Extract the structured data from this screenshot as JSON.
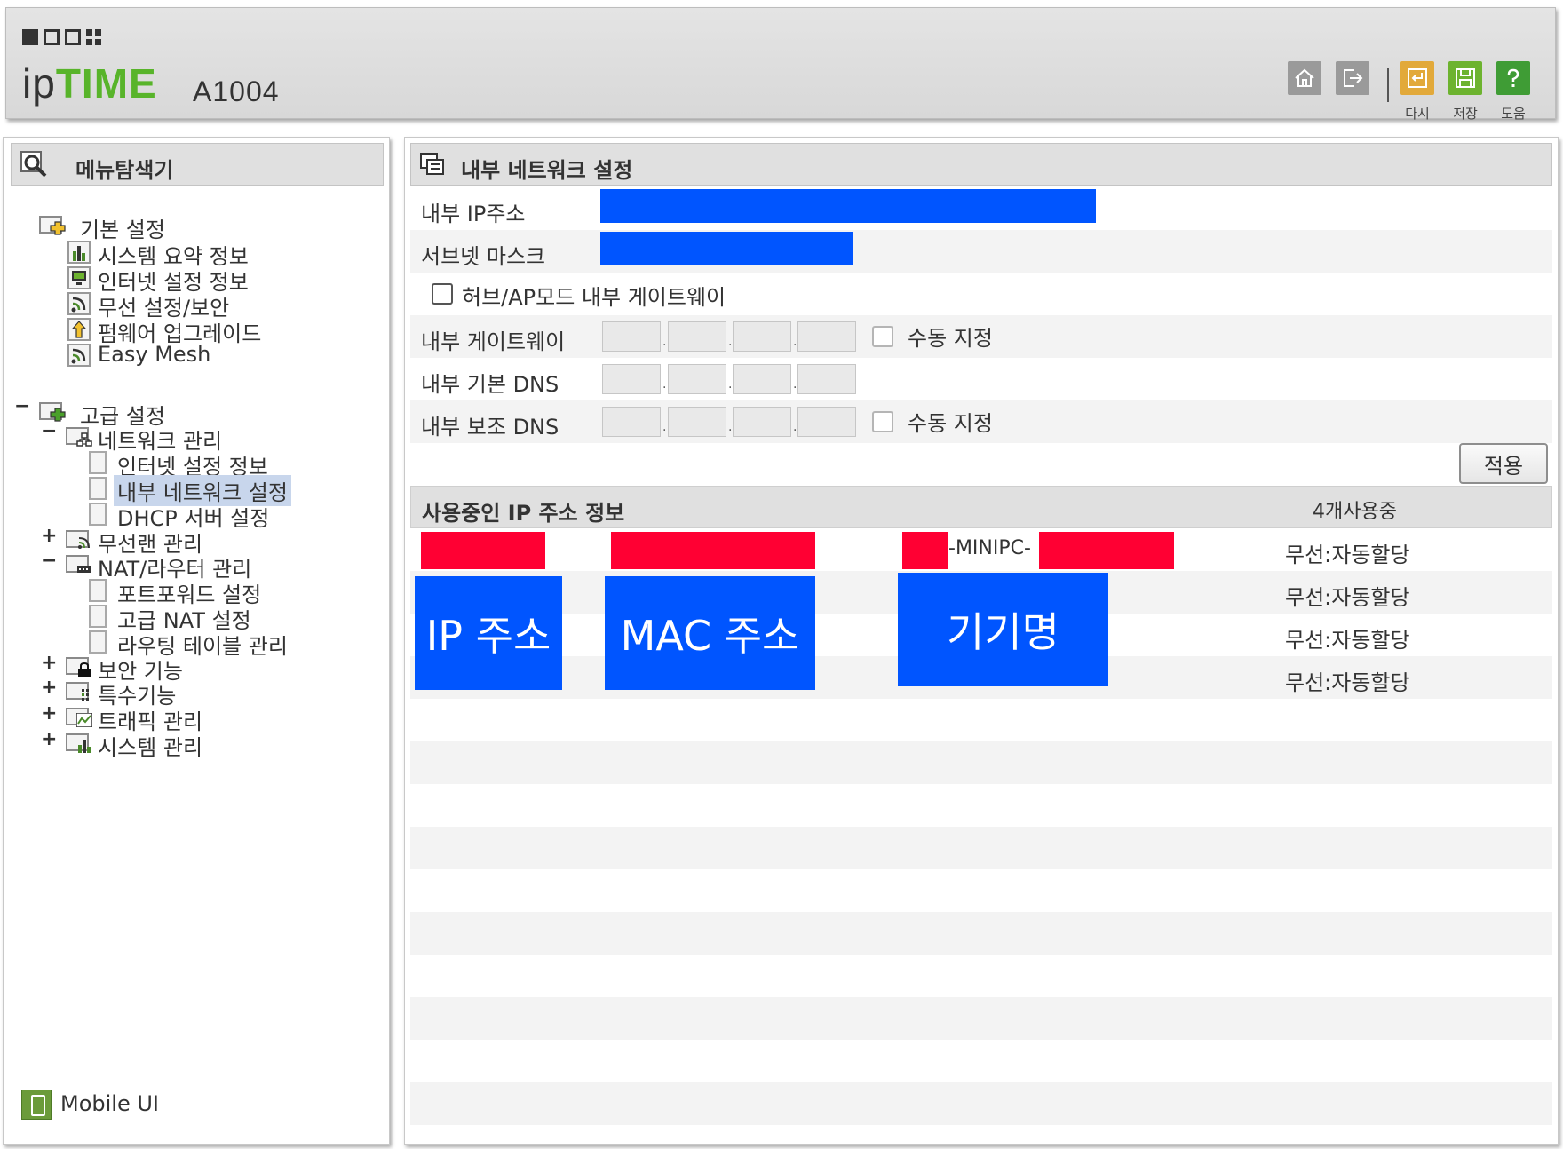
{
  "header": {
    "brand_ip": "ip",
    "brand_time": "TIME",
    "model": "A1004",
    "buttons": {
      "home_icon": "home-icon",
      "logout_icon": "logout-icon",
      "reload_label": "다시",
      "save_label": "저장",
      "help_label": "도움"
    },
    "colors": {
      "reload": "#e2a93a",
      "save": "#6db32f",
      "help": "#3f9c35",
      "gray": "#9a9a9a"
    }
  },
  "sidebar": {
    "title": "메뉴탐색기",
    "basic": {
      "label": "기본 설정",
      "items": [
        "시스템 요약 정보",
        "인터넷 설정 정보",
        "무선 설정/보안",
        "펌웨어 업그레이드",
        "Easy Mesh"
      ]
    },
    "advanced": {
      "label": "고급 설정",
      "network": {
        "label": "네트워크 관리",
        "items": [
          "인터넷 설정 정보",
          "내부 네트워크 설정",
          "DHCP 서버 설정"
        ],
        "selected": "내부 네트워크 설정"
      },
      "wireless": "무선랜 관리",
      "nat": {
        "label": "NAT/라우터 관리",
        "items": [
          "포트포워드 설정",
          "고급 NAT 설정",
          "라우팅 테이블 관리"
        ]
      },
      "security": "보안 기능",
      "special": "특수기능",
      "traffic": "트래픽 관리",
      "system": "시스템 관리"
    },
    "mobile_ui": "Mobile UI"
  },
  "main": {
    "title": "내부 네트워크 설정",
    "form": {
      "ip_label": "내부 IP주소",
      "subnet_label": "서브넷 마스크",
      "hubap_label": "허브/AP모드 내부 게이트웨이",
      "gateway_label": "내부 게이트웨이",
      "gateway_manual": "수동 지정",
      "dns1_label": "내부 기본 DNS",
      "dns2_label": "내부 보조 DNS",
      "dns2_manual": "수동 지정",
      "apply": "적용"
    },
    "ip_list": {
      "title": "사용중인 IP 주소 정보",
      "count": "4개사용중",
      "minipc_text": "-MINIPC-",
      "rows": [
        {
          "status": "무선:자동할당"
        },
        {
          "status": "무선:자동할당"
        },
        {
          "status": "무선:자동할당"
        },
        {
          "status": "무선:자동할당"
        }
      ],
      "overlays": {
        "ip": "IP 주소",
        "mac": "MAC 주소",
        "device": "기기명"
      }
    },
    "colors": {
      "redact_red": "#ff0033",
      "redact_blue": "#0055ff"
    }
  }
}
